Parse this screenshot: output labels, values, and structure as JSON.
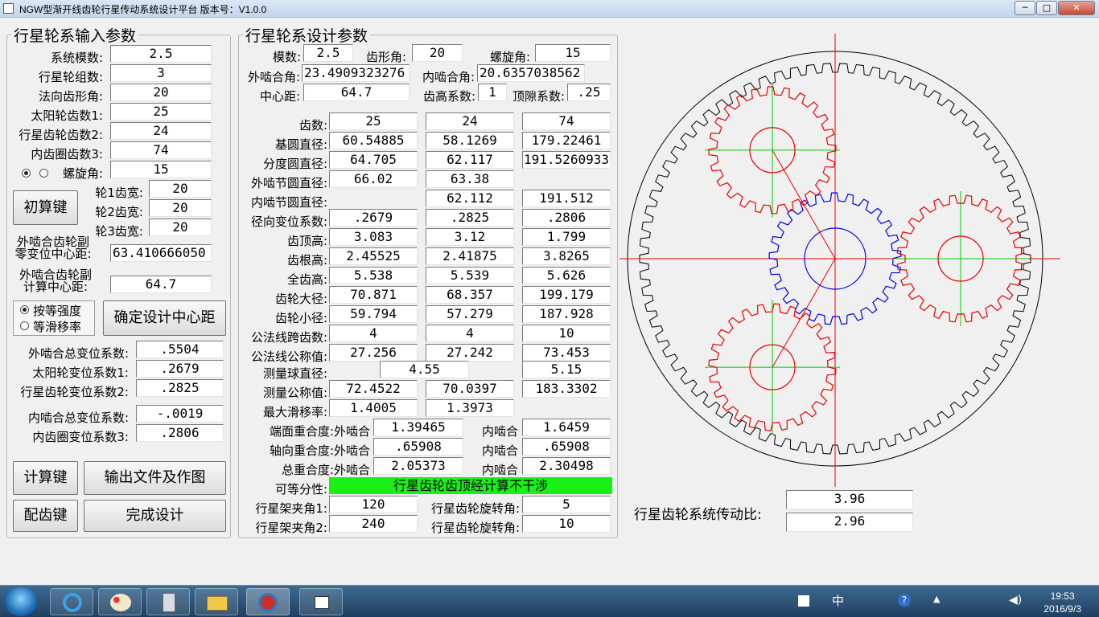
{
  "window": {
    "title": "NGW型渐开线齿轮行星传动系统设计平台  版本号：V1.0.0",
    "min": "─",
    "max": "□",
    "close": "✕"
  },
  "input_panel": {
    "legend": "行星轮系输入参数",
    "module_label": "系统模数:",
    "module": "2.5",
    "planet_count_label": "行星轮组数:",
    "planet_count": "3",
    "pressure_angle_label": "法向齿形角:",
    "pressure_angle": "20",
    "sun_teeth_label": "太阳轮齿数1:",
    "sun_teeth": "25",
    "planet_teeth_label": "行星齿轮齿数2:",
    "planet_teeth": "24",
    "ring_teeth_label": "内齿圈齿数3:",
    "ring_teeth": "74",
    "helix_label": "螺旋角:",
    "helix": "15",
    "init_button": "初算键",
    "width1_label": "轮1齿宽:",
    "width1": "20",
    "width2_label": "轮2齿宽:",
    "width2": "20",
    "width3_label": "轮3齿宽:",
    "width3": "20",
    "zero_center_label1": "外啮合齿轮副",
    "zero_center_label2": "零变位中心距:",
    "zero_center": "63.410666050",
    "calc_center_label1": "外啮合齿轮副",
    "calc_center_label2": "计算中心距:",
    "calc_center": "64.7",
    "radio_strength": "按等强度",
    "radio_slip": "等滑移率",
    "confirm_button": "确定设计中心距",
    "ext_total_shift_label": "外啮合总变位系数:",
    "ext_total_shift": ".5504",
    "sun_shift_label": "太阳轮变位系数1:",
    "sun_shift": ".2679",
    "planet_shift_label": "行星齿轮变位系数2:",
    "planet_shift": ".2825",
    "int_total_shift_label": "内啮合总变位系数:",
    "int_total_shift": "-.0019",
    "ring_shift_label": "内齿圈变位系数3:",
    "ring_shift": ".2806",
    "calc_button": "计算键",
    "output_button": "输出文件及作图",
    "match_button": "配齿键",
    "finish_button": "完成设计"
  },
  "design_panel": {
    "legend": "行星轮系设计参数",
    "module_label": "模数:",
    "module": "2.5",
    "profile_label": "齿形角:",
    "profile": "20",
    "helix_label": "螺旋角:",
    "helix": "15",
    "ext_angle_label": "外啮合角:",
    "ext_angle": "23.4909323276",
    "int_angle_label": "内啮合角:",
    "int_angle": "20.6357038562",
    "center_label": "中心距:",
    "center": "64.7",
    "addendum_coef_label": "齿高系数:",
    "addendum_coef": "1",
    "clearance_label": "顶隙系数:",
    "clearance": ".25",
    "rows": [
      {
        "label": "齿数:",
        "v": [
          "25",
          "24",
          "74"
        ]
      },
      {
        "label": "基圆直径:",
        "v": [
          "60.54885",
          "58.1269",
          "179.22461"
        ]
      },
      {
        "label": "分度圆直径:",
        "v": [
          "64.705",
          "62.117",
          "191.5260933"
        ]
      },
      {
        "label": "外啮节圆直径:",
        "v": [
          "66.02",
          "63.38",
          ""
        ]
      },
      {
        "label": "内啮节圆直径:",
        "v": [
          "",
          "62.112",
          "191.512"
        ]
      },
      {
        "label": "径向变位系数:",
        "v": [
          ".2679",
          ".2825",
          ".2806"
        ]
      },
      {
        "label": "齿顶高:",
        "v": [
          "3.083",
          "3.12",
          "1.799"
        ]
      },
      {
        "label": "齿根高:",
        "v": [
          "2.45525",
          "2.41875",
          "3.8265"
        ]
      },
      {
        "label": "全齿高:",
        "v": [
          "5.538",
          "5.539",
          "5.626"
        ]
      },
      {
        "label": "齿轮大径:",
        "v": [
          "70.871",
          "68.357",
          "199.179"
        ]
      },
      {
        "label": "齿轮小径:",
        "v": [
          "59.794",
          "57.279",
          "187.928"
        ]
      },
      {
        "label": "公法线跨齿数:",
        "v": [
          "4",
          "4",
          "10"
        ]
      },
      {
        "label": "公法线公称值:",
        "v": [
          "27.256",
          "27.242",
          "73.453"
        ]
      }
    ],
    "ball_label": "测量球直径:",
    "ball_12": "4.55",
    "ball_3": "5.15",
    "meas_label": "测量公称值:",
    "meas": [
      "72.4522",
      "70.0397",
      "183.3302"
    ],
    "slip_label": "最大滑移率:",
    "slip": [
      "1.4005",
      "1.3973"
    ],
    "face_label": "端面重合度:外啮合",
    "face_ext": "1.39465",
    "face_int_label": "内啮合",
    "face_int": "1.6459",
    "axial_label": "轴向重合度:外啮合",
    "axial_ext": ".65908",
    "axial_int_label": "内啮合",
    "axial_int": ".65908",
    "total_label": "总重合度:外啮合",
    "total_ext": "2.05373",
    "total_int_label": "内啮合",
    "total_int": "2.30498",
    "equal_label": "可等分性:",
    "equal_status": "行星齿轮齿顶经计算不干涉",
    "equal_color": "#18f018",
    "carrier1_label": "行星架夹角1:",
    "carrier1": "120",
    "rot1_label": "行星齿轮旋转角:",
    "rot1": "5",
    "carrier2_label": "行星架夹角2:",
    "carrier2": "240",
    "rot2_label": "行星齿轮旋转角:",
    "rot2": "10"
  },
  "ratio": {
    "label": "行星齿轮系统传动比:",
    "value1": "3.96",
    "value2": "2.96"
  },
  "drawing": {
    "sun_teeth": 25,
    "planet_teeth": 24,
    "ring_teeth": 74,
    "planet_count": 3,
    "sun_color": "#0000ee",
    "planet_color": "#ee0000",
    "ring_color": "#000000",
    "axis_color": "#ee0000",
    "planet_axis_color": "#00cc00"
  },
  "taskbar": {
    "time": "19:53",
    "date": "2016/9/3",
    "ime": "中"
  }
}
